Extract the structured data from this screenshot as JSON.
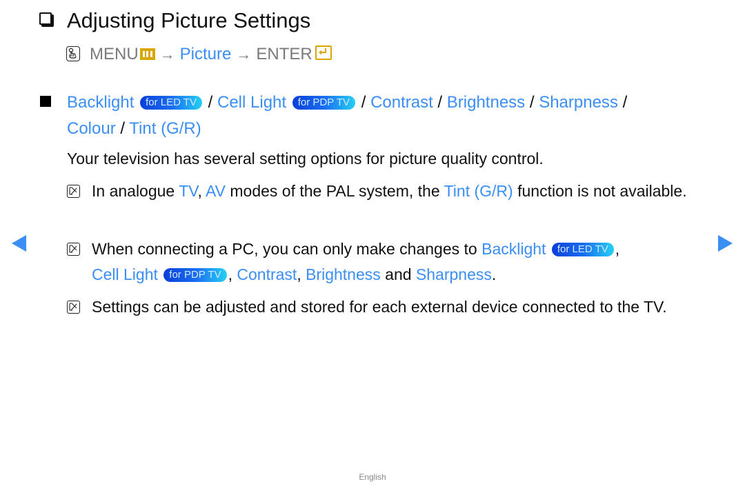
{
  "heading": {
    "title": "Adjusting Picture Settings"
  },
  "menu_path": {
    "menu_label": "MENU",
    "arrow": "→",
    "picture_label": "Picture",
    "enter_label": "ENTER"
  },
  "section": {
    "items": [
      {
        "label": "Backlight",
        "badge": "for LED TV"
      },
      {
        "label": "Cell Light",
        "badge": "for PDP TV"
      },
      {
        "label": "Contrast"
      },
      {
        "label": "Brightness"
      },
      {
        "label": "Sharpness"
      },
      {
        "label": "Colour"
      },
      {
        "label": "Tint (G/R)"
      }
    ],
    "separator": " / "
  },
  "intro": "Your television has several setting options for picture quality control.",
  "notes": [
    {
      "pre": "In analogue ",
      "tv": "TV",
      "comma": ", ",
      "av": "AV",
      "mid": " modes of the PAL system, the ",
      "tint": "Tint (G/R)",
      "post": " function is not available."
    },
    {
      "pre": "When connecting a PC, you can only make changes to ",
      "backlight": "Backlight",
      "backlight_badge": "for LED TV",
      "comma1": ", ",
      "cell_light": "Cell Light",
      "cell_light_badge": "for PDP TV",
      "comma2": ", ",
      "contrast": "Contrast",
      "comma3": ", ",
      "brightness": "Brightness",
      "and": " and ",
      "sharpness": "Sharpness",
      "period": "."
    },
    {
      "text": "Settings can be adjusted and stored for each external device connected to the TV."
    }
  ],
  "footer": {
    "language": "English"
  },
  "colors": {
    "link_blue": "#3a8ef6",
    "menu_grey": "#7a7a7a",
    "icon_gold": "#d9a700"
  }
}
